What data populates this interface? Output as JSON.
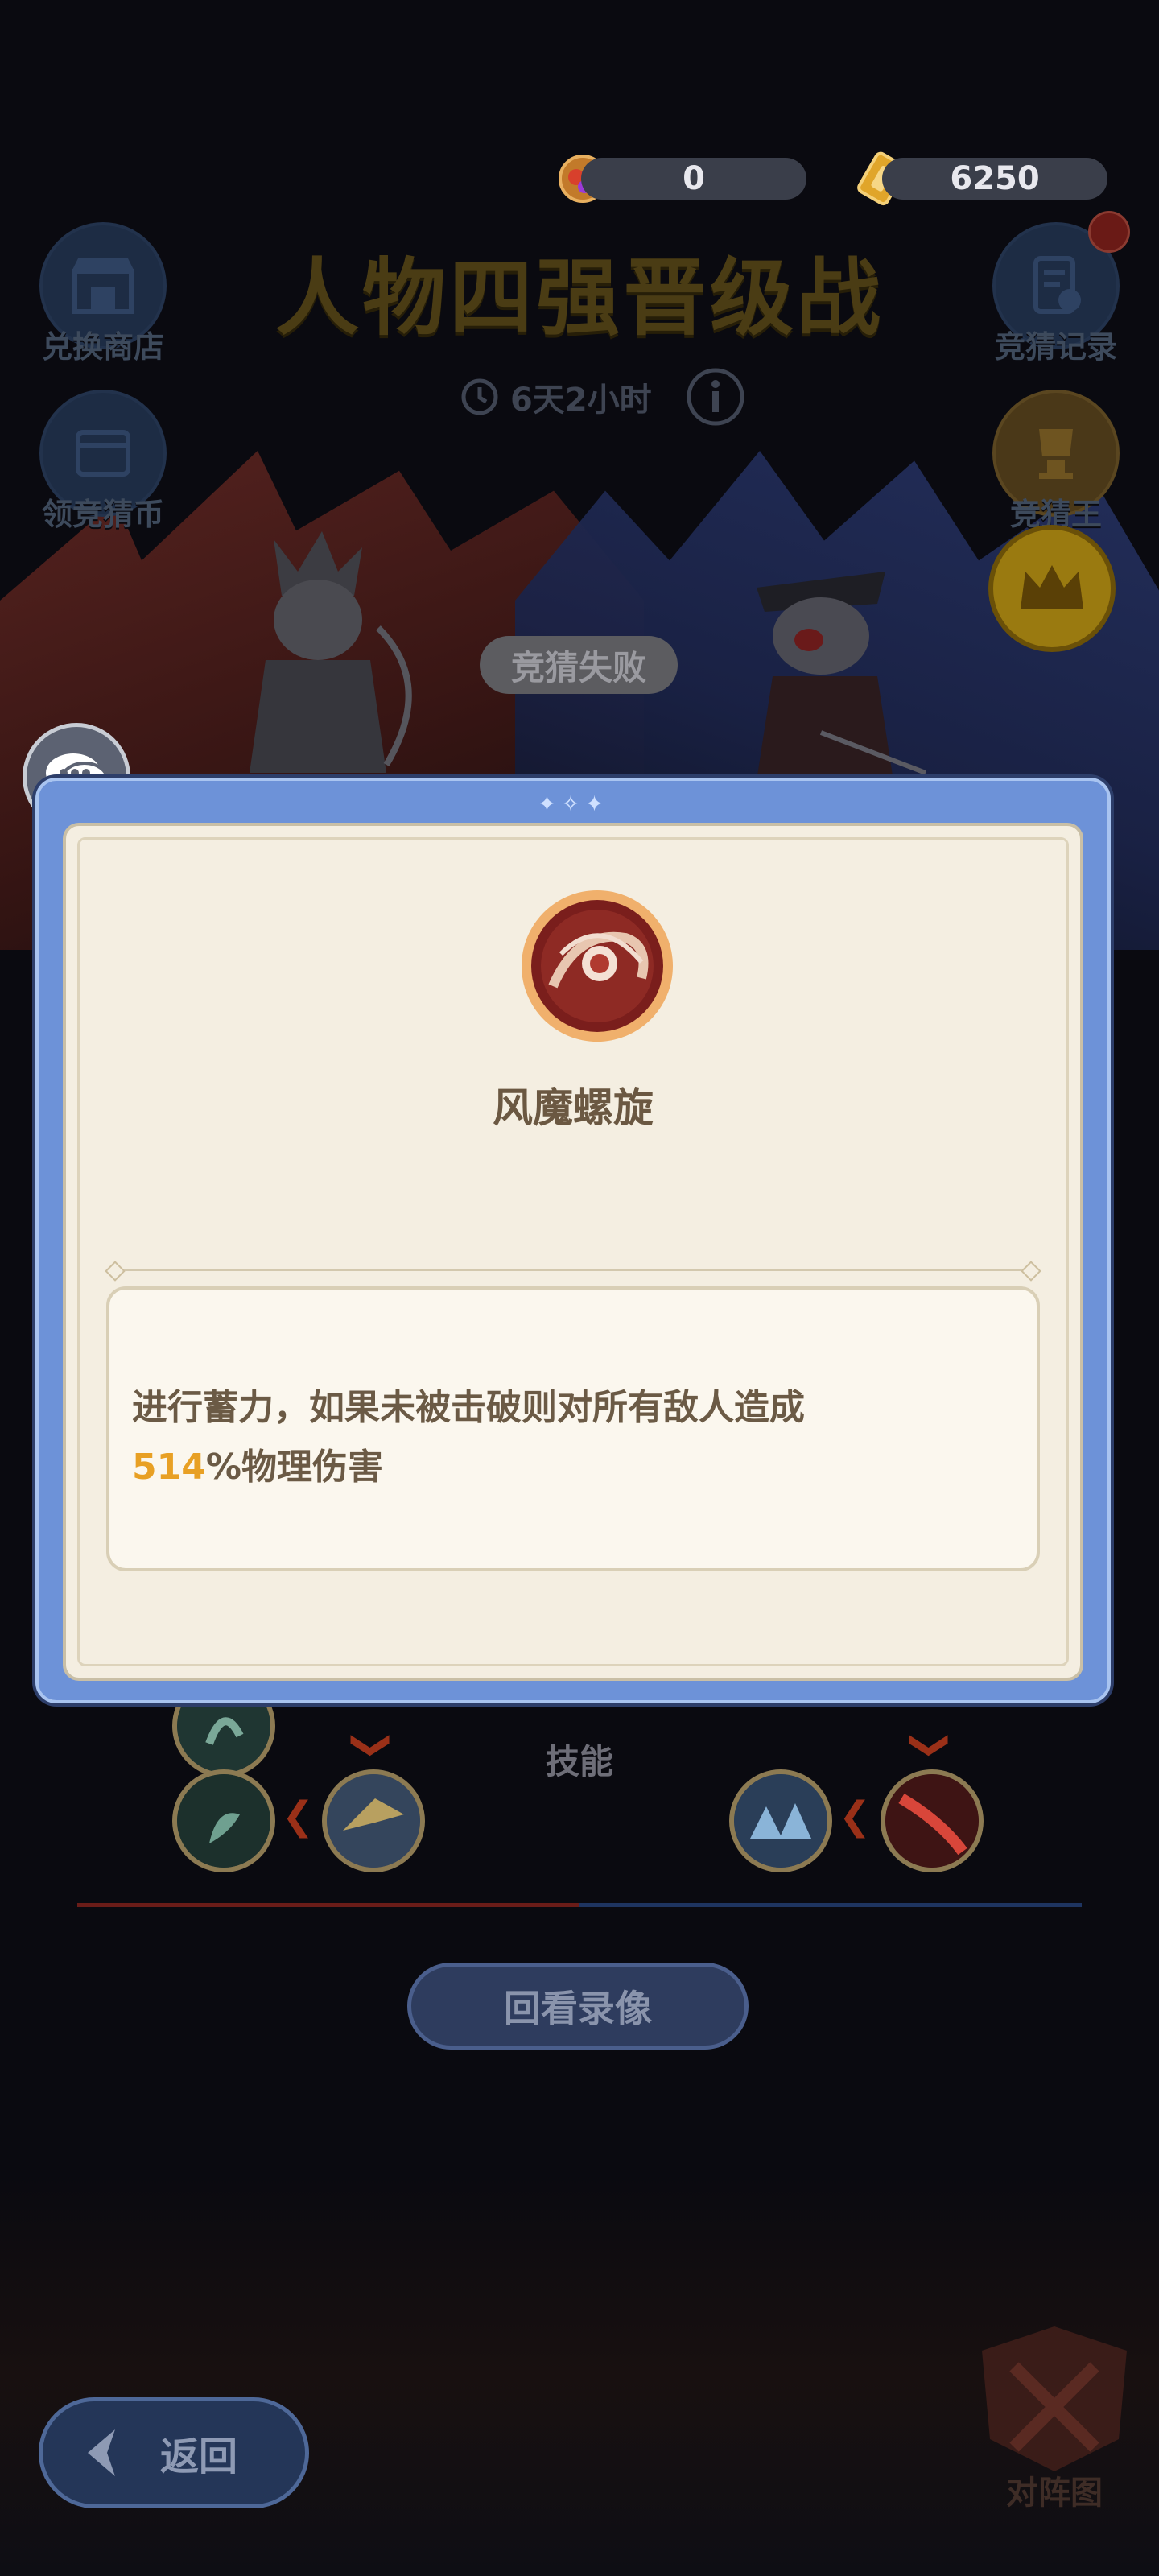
{
  "currency": {
    "gem_value": "0",
    "ticket_value": "6250"
  },
  "shortcuts": {
    "exchange_shop": "兑换商店",
    "claim_rewards": "领竞猜币",
    "guess_record": "竞猜记录",
    "guess_king": "竞猜王"
  },
  "event": {
    "title": "人物四强晋级战",
    "timer": "6天2小时",
    "result_badge": "竞猜失败"
  },
  "skill_popup": {
    "name": "风魔螺旋",
    "description_line1": "进行蓄力，如果未被击破则对所有敌人造成",
    "damage_percent": "514",
    "description_tail": "%物理伤害"
  },
  "matchup": {
    "skills_label": "技能",
    "replay_button": "回看录像",
    "lineup_label": "对阵图"
  },
  "nav": {
    "back_label": "返回"
  },
  "colors": {
    "modal_frame": "#6d92d8",
    "modal_inner": "#f4eee1",
    "highlight": "#e8a024",
    "team_red": "#5a2420",
    "team_blue": "#24305e"
  }
}
